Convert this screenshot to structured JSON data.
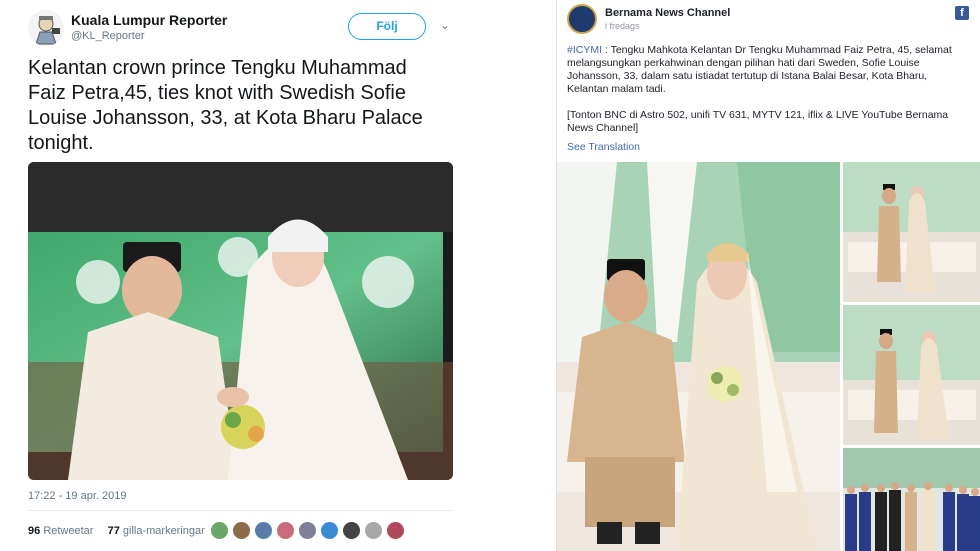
{
  "tweet": {
    "author_name": "Kuala Lumpur Reporter",
    "author_handle": "@KL_Reporter",
    "follow_label": "Följ",
    "caret": "⌄",
    "text": "Kelantan crown prince Tengku Muhammad Faiz Petra,45, ties knot with Swedish Sofie Louise Johansson, 33, at Kota Bharu Palace tonight.",
    "timestamp": "17:22 - 19 apr. 2019",
    "retweet_count": "96",
    "retweet_label": "Retweetar",
    "like_count": "77",
    "like_label": "gilla-markeringar",
    "liker_avatar_colors": [
      "#6aa56a",
      "#8b6b4a",
      "#5a7da8",
      "#c96b7a",
      "#7f7f9a",
      "#3b8ad6",
      "#444444",
      "#a8a8a8",
      "#b04a5a"
    ]
  },
  "facebook": {
    "page_name": "Bernama News Channel",
    "post_time": "i fredags",
    "hashtag": "#ICYMI",
    "body": " : Tengku Mahkota Kelantan Dr Tengku Muhammad Faiz Petra, 45, selamat melangsungkan perkahwinan dengan pilihan hati dari Sweden, Sofie Louise Johansson, 33, dalam satu istiadat tertutup di Istana Balai Besar, Kota Bharu, Kelantan malam tadi.",
    "body2": "[Tonton BNC di Astro 502, unifi TV 631, MYTV 121, iflix & LIVE YouTube Bernama News Channel]",
    "translate_label": "See Translation",
    "fb_icon": "f"
  }
}
